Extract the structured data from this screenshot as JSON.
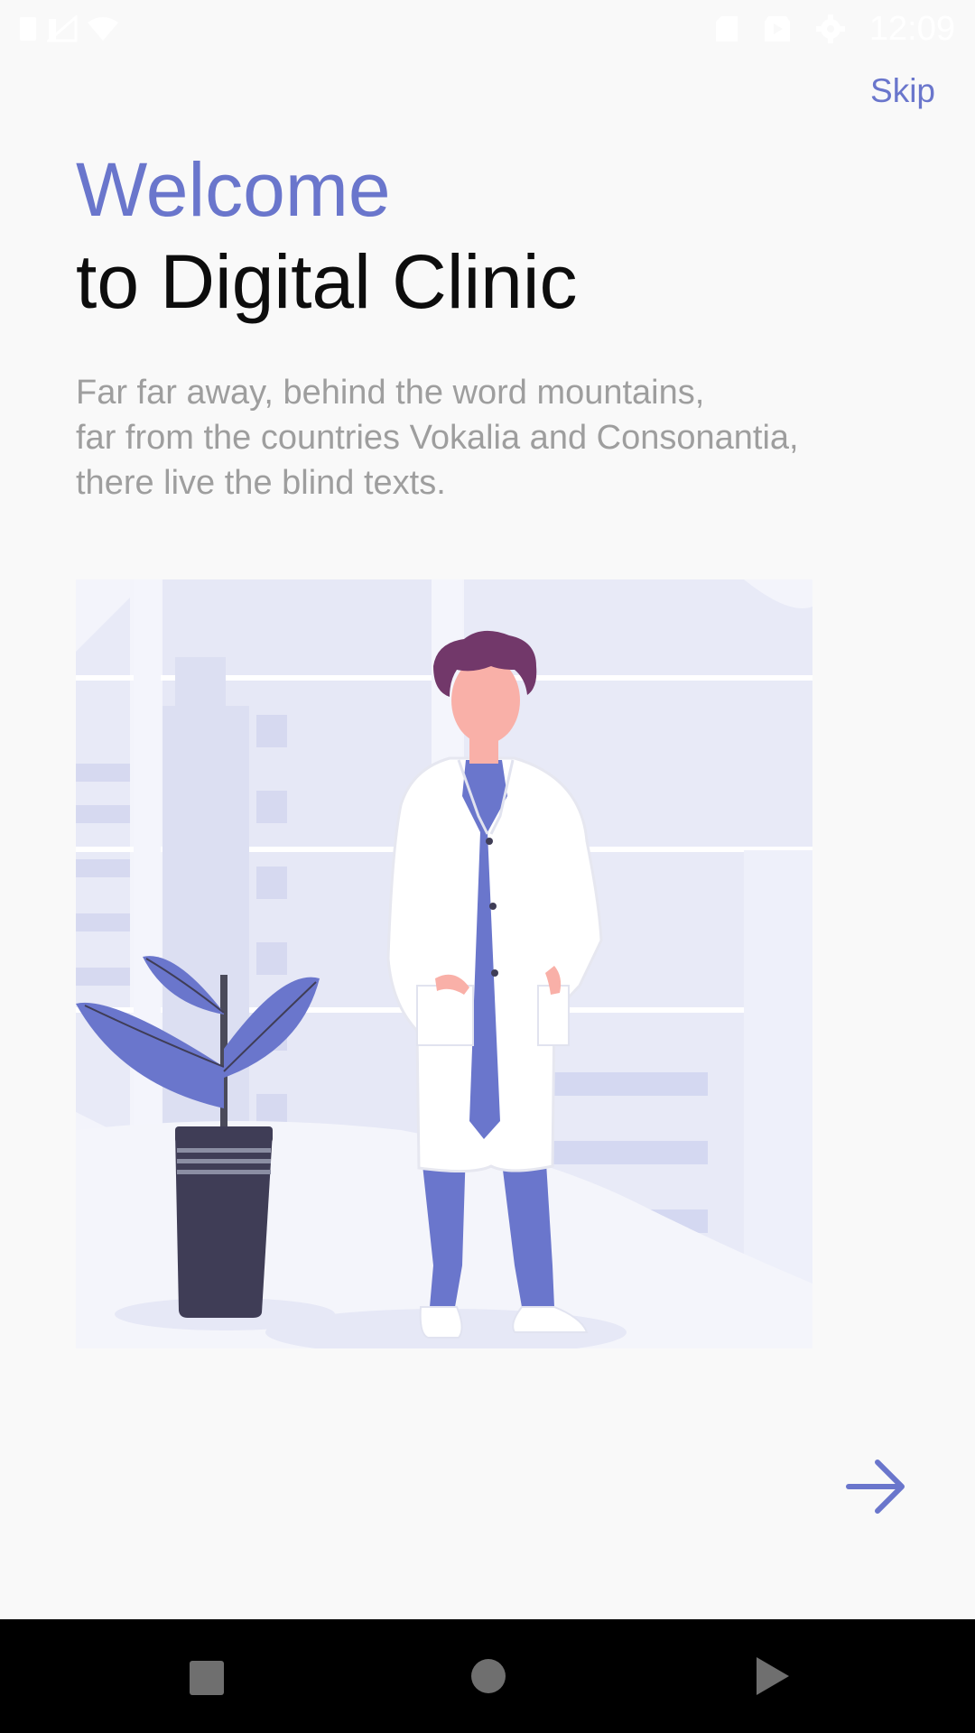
{
  "status_bar": {
    "time": "12:09",
    "icons_left": [
      "battery-icon",
      "signal-icon",
      "wifi-icon"
    ],
    "icons_right": [
      "sd-card-icon",
      "play-store-icon",
      "settings-icon"
    ]
  },
  "header": {
    "skip_label": "Skip"
  },
  "hero": {
    "welcome": "Welcome",
    "subtitle": "to Digital Clinic",
    "description_lines": [
      "Far far away, behind the word mountains,",
      "far from the countries Vokalia and Consonantia,",
      "there live the blind texts."
    ]
  },
  "illustration": {
    "subject": "doctor-with-plant-illustration"
  },
  "footer": {
    "next_icon": "arrow-right-icon"
  },
  "nav_bar": {
    "buttons": [
      "recents-square-icon",
      "home-circle-icon",
      "back-triangle-icon"
    ]
  },
  "colors": {
    "accent": "#6a76cc",
    "title": "#0d0d0d",
    "description": "#9e9e9e",
    "background": "#f9f9f9",
    "nav_bar": "#000000"
  }
}
